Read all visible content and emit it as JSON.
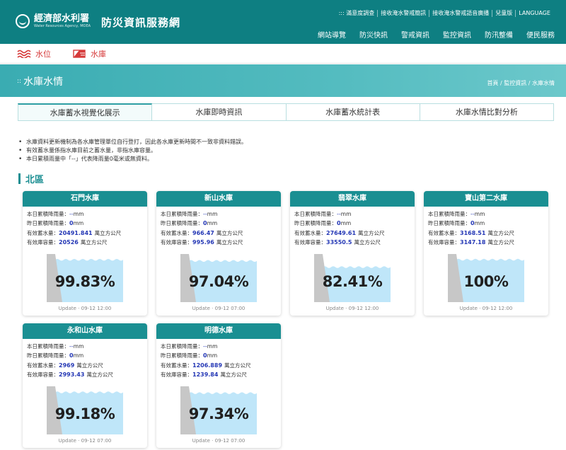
{
  "header": {
    "logo_cn": "經濟部水利署",
    "logo_en": "Water Resources Agency, MOEA",
    "site_title": "防災資訊服務網",
    "util_links": [
      "::: 滿意度調查",
      "接收淹水警戒簡訊",
      "接收淹水警戒語音廣播",
      "兒童版",
      "LANGUAGE"
    ],
    "main_nav": [
      "網站導覽",
      "防災快訊",
      "警戒資訊",
      "監控資訊",
      "防汛整備",
      "便民服務"
    ]
  },
  "subnav": {
    "items": [
      {
        "label": "水位",
        "icon": "water-level-wave-icon"
      },
      {
        "label": "水庫",
        "icon": "reservoir-icon"
      }
    ],
    "accent_color": "#d63a3a"
  },
  "banner": {
    "title": "水庫水情",
    "breadcrumb": "首頁 / 監控資訊 / 水庫水情"
  },
  "tabs": [
    {
      "label": "水庫蓄水視覺化展示",
      "active": true
    },
    {
      "label": "水庫即時資訊",
      "active": false
    },
    {
      "label": "水庫蓄水統計表",
      "active": false
    },
    {
      "label": "水庫水情比對分析",
      "active": false
    }
  ],
  "notes": [
    "水庫資料更新機制為各水庫管理單位自行登打，因此各水庫更新時間不一致非資料錯誤。",
    "有效蓄水量係指水庫目前之蓄水量，非指水庫容量。",
    "本日累積雨量中「--」代表降雨量0毫米或無資料。"
  ],
  "region_title": "北區",
  "labels": {
    "rain_today": "本日累積降雨量：",
    "rain_yesterday": "昨日累積降雨量：",
    "storage": "有效蓄水量：",
    "capacity": "有效庫容量：",
    "unit_mm": "mm",
    "unit_volume": "萬立方公尺",
    "update_prefix": "Update · "
  },
  "reservoirs": [
    {
      "name": "石門水庫",
      "rain_today": "--",
      "rain_yesterday": "0",
      "storage": "20491.841",
      "capacity": "20526",
      "percent": "99.83%",
      "level": 0.9983,
      "update": "09-12 12:00"
    },
    {
      "name": "新山水庫",
      "rain_today": "--",
      "rain_yesterday": "0",
      "storage": "966.47",
      "capacity": "995.96",
      "percent": "97.04%",
      "level": 0.9704,
      "update": "09-12 07:00"
    },
    {
      "name": "翡翠水庫",
      "rain_today": "--",
      "rain_yesterday": "0",
      "storage": "27649.61",
      "capacity": "33550.5",
      "percent": "82.41%",
      "level": 0.8241,
      "update": "09-12 12:00"
    },
    {
      "name": "寶山第二水庫",
      "rain_today": "--",
      "rain_yesterday": "0",
      "storage": "3168.51",
      "capacity": "3147.18",
      "percent": "100%",
      "level": 1.0,
      "update": "09-12 12:00"
    },
    {
      "name": "永和山水庫",
      "rain_today": "--",
      "rain_yesterday": "0",
      "storage": "2969",
      "capacity": "2993.43",
      "percent": "99.18%",
      "level": 0.9918,
      "update": "09-12 07:00"
    },
    {
      "name": "明德水庫",
      "rain_today": "--",
      "rain_yesterday": "0",
      "storage": "1206.889",
      "capacity": "1239.84",
      "percent": "97.34%",
      "level": 0.9734,
      "update": "09-12 07:00"
    }
  ],
  "colors": {
    "header_bg": "#0e7f82",
    "card_head": "#1a8f92",
    "water": "#bfe6f9",
    "dam": "#c7c7c7",
    "value_blue": "#2437b5"
  }
}
